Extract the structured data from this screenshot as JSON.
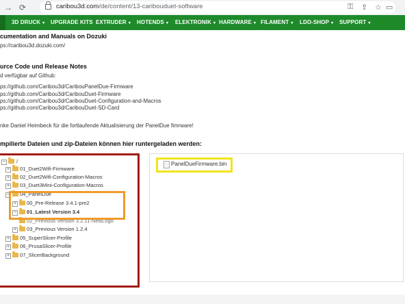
{
  "browser": {
    "url_domain": "caribou3d.com",
    "url_path": "/de/content/13-caribouduet-software"
  },
  "nav": {
    "items": [
      {
        "label": "3D DRUCK"
      },
      {
        "label": "UPGRADE KITS"
      },
      {
        "label": "EXTRUDER"
      },
      {
        "label": "HOTENDS"
      },
      {
        "label": "ELEKTRONIK"
      },
      {
        "label": "HARDWARE"
      },
      {
        "label": "FILAMENT"
      },
      {
        "label": "LDO-SHOP"
      },
      {
        "label": "SUPPORT"
      }
    ],
    "chevron": "▾"
  },
  "content": {
    "heading1": "cumentation and Manuals on Dozuki",
    "link1": "ps://caribou3d.dozuki.com/",
    "heading2": "urce Code und Release Notes",
    "github_note": "d verfügbar auf Github:",
    "links": [
      "ps://github.com/Caribou3d/CaribouPanelDue-Firmware",
      "ps://github.com/Caribou3d/CaribouDuet-Firmware",
      "ps://github.com/Caribou3d/CaribouDuet-Configuration-and-Macros",
      "ps://github.com/Caribou3d/CaribouDuet-SD-Card"
    ],
    "thanks": "nke Daniel Heimbeck für die fortlaufende Aktualisierung der PanelDue fimrware!",
    "heading3": "mpilierte Dateien und zip-Dateien können hier runtergeladen werden:"
  },
  "tree": {
    "root": "/",
    "items": [
      {
        "label": "01_Duet2Wifi-Firmware",
        "toggle": "+"
      },
      {
        "label": "02_Duet2Wifi-Configuration-Macros",
        "toggle": "+"
      },
      {
        "label": "03_Duet3Mini-Configuration-Macros",
        "toggle": "+"
      },
      {
        "label": "04_PanelDue",
        "toggle": "−"
      },
      {
        "label": "00_Pre-Release 3.4.1-pre2",
        "toggle": "+"
      },
      {
        "label": "01_Latest Version 3.4",
        "toggle": "−"
      },
      {
        "label": "02_Previous Version 3.2.11-NewLogo",
        "toggle": ""
      },
      {
        "label": "03_Previous Version 1.2.4",
        "toggle": "+"
      },
      {
        "label": "05_SuperSlicer-Profile",
        "toggle": "+"
      },
      {
        "label": "06_PrusaSlicer-Profile",
        "toggle": "+"
      },
      {
        "label": "07_SlicerBackground",
        "toggle": "+"
      }
    ]
  },
  "files": {
    "items": [
      "PanelDueFirmware.bin"
    ]
  }
}
